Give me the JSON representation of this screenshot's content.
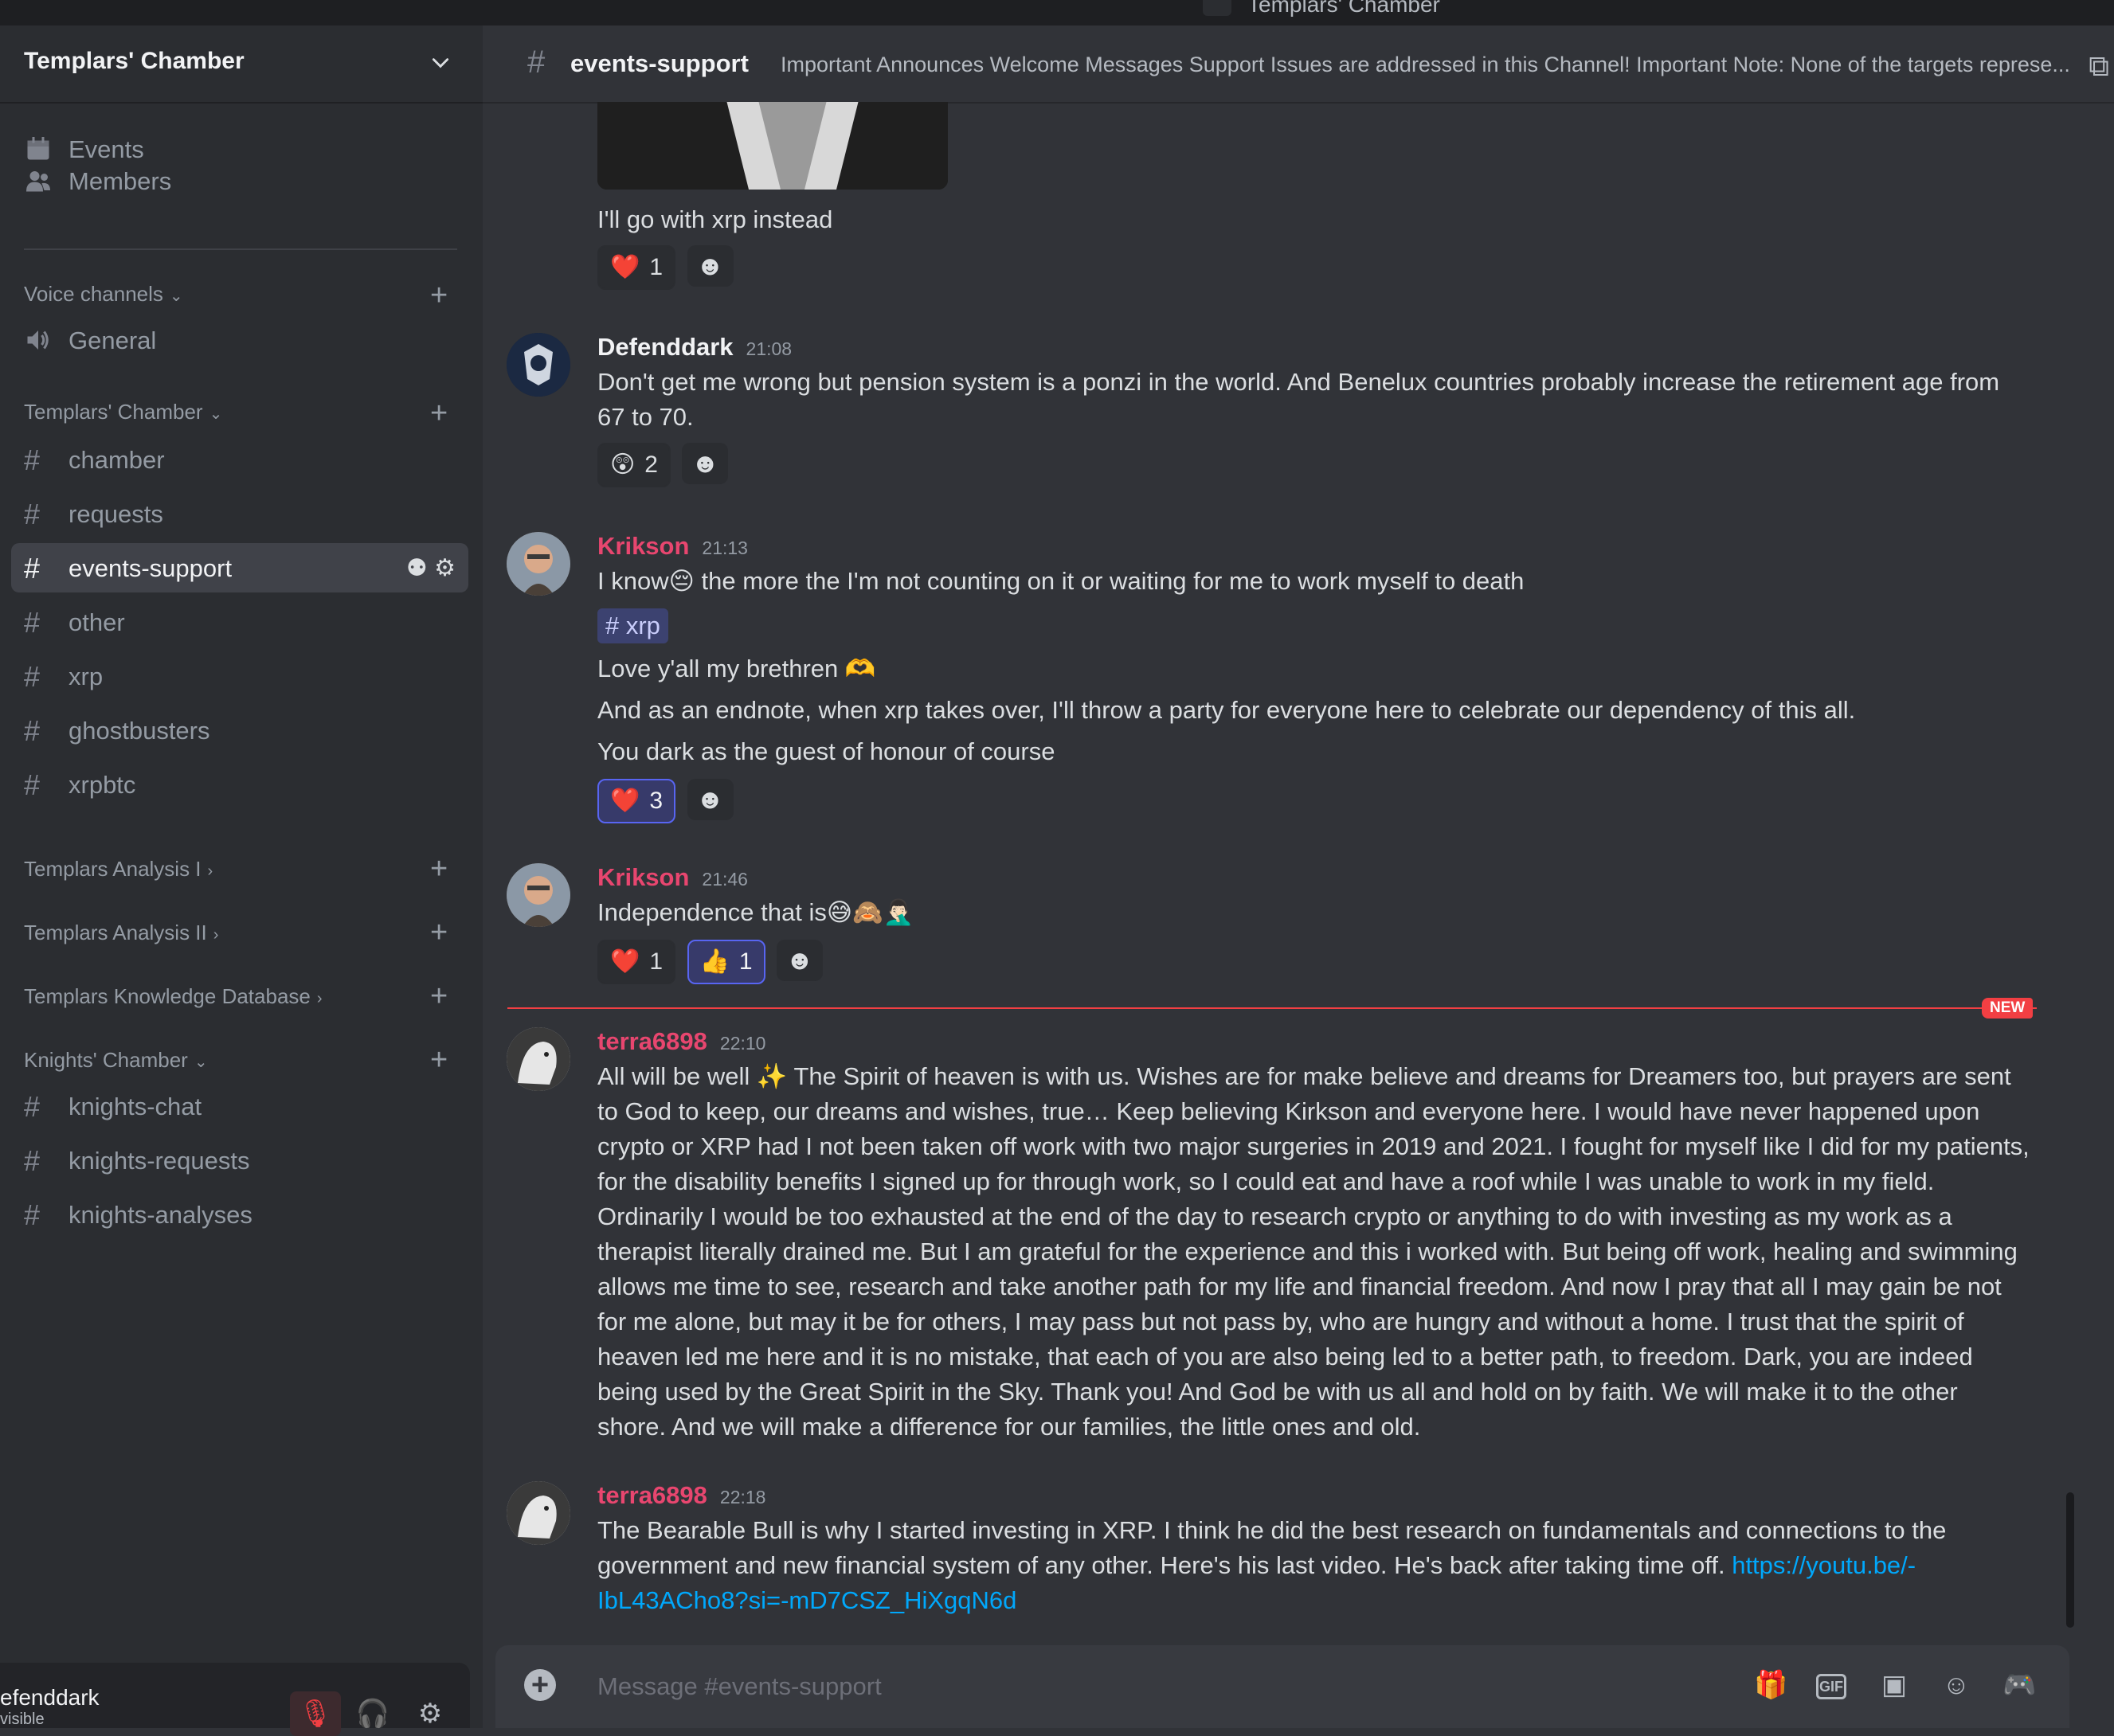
{
  "window": {
    "title": "Templars' Chamber"
  },
  "sidebar": {
    "server_name": "Templars' Chamber",
    "top_items": [
      {
        "label": "Events",
        "icon": "calendar-icon"
      },
      {
        "label": "Members",
        "icon": "members-icon"
      }
    ],
    "categories": {
      "voice": "Voice channels",
      "templars_chamber": "Templars' Chamber",
      "analysis_1": "Templars Analysis I",
      "analysis_2": "Templars Analysis II",
      "knowledge": "Templars Knowledge Database",
      "knights": "Knights' Chamber"
    },
    "voice_channels": [
      "General"
    ],
    "channels": [
      "chamber",
      "requests",
      "events-support",
      "other",
      "xrp",
      "ghostbusters",
      "xrpbtc"
    ],
    "active_channel": "events-support",
    "knights_channels": [
      "knights-chat",
      "knights-requests",
      "knights-analyses"
    ]
  },
  "user_panel": {
    "name": "efenddark",
    "status": "visible"
  },
  "channel": {
    "name": "events-support",
    "topic": "Important Announces Welcome Messages Support Issues are addressed in this Channel! Important Note: None of the targets represe..."
  },
  "messages": [
    {
      "author": "",
      "time": "",
      "text": "I'll go with xrp instead",
      "reactions": [
        {
          "emoji": "❤️",
          "count": "1",
          "mine": false
        }
      ]
    },
    {
      "author": "Defenddark",
      "time": "21:08",
      "text": "Don't get me wrong but pension system is a ponzi in the world. And Benelux countries probably increase the retirement age from 67 to 70.",
      "reactions": [
        {
          "emoji": "😲",
          "count": "2",
          "mine": false
        }
      ]
    },
    {
      "author": "Krikson",
      "time": "21:13",
      "line1": "I know😔 the  more the I'm not counting on it or waiting for me to work myself to death",
      "mention": "xrp",
      "line2": "Love y'all my brethren 🫶",
      "line3": "And as an endnote, when xrp takes over, I'll throw a party for everyone here to celebrate our dependency of this all.",
      "line4": "You dark as the guest of honour of course",
      "reactions": [
        {
          "emoji": "❤️",
          "count": "3",
          "mine": true
        }
      ]
    },
    {
      "author": "Krikson",
      "time": "21:46",
      "text": "Independence that is😅🙈🤦🏻‍♂️",
      "reactions": [
        {
          "emoji": "❤️",
          "count": "1",
          "mine": false
        },
        {
          "emoji": "👍",
          "count": "1",
          "mine": true
        }
      ]
    },
    {
      "author": "terra6898",
      "time": "22:10",
      "text": "All will be well ✨ The Spirit of heaven is with us. Wishes are for make believe and dreams for Dreamers too, but prayers are sent to God to keep, our dreams and wishes,  true… Keep believing Kirkson and everyone here. I would have never happened upon crypto or XRP had I not been taken off work with two major surgeries in 2019 and 2021.  I fought for myself like I did for my patients, for the disability benefits I signed up for through work, so I could eat and have a roof while I was  unable to work in my field. Ordinarily I would be too exhausted at the end of the day to research crypto or anything to do with investing as my work as a therapist literally drained me. But I am grateful for the experience and this i worked with. But being off work, healing and swimming allows me time to see, research and take another path for my life and financial freedom. And now I pray that all I may gain be not for me alone, but may it be for others, I may pass but not pass by,  who are hungry and without a home. I trust that the spirit of heaven led me here and it is no mistake, that each of you are also being led to a better path,  to freedom. Dark, you are  indeed being used by the Great Spirit in the Sky. Thank you! And God be with us all and hold on by faith. We will make it to the other shore. And we will make a difference for our families, the little ones and old."
    },
    {
      "author": "terra6898",
      "time": "22:18",
      "text": "The Bearable Bull is why I started investing in XRP. I think he did the best research on fundamentals and connections to the government and new financial system of any other. Here's his last video. He's back after taking time off. ",
      "link": "https://youtu.be/-IbL43ACho8?si=-mD7CSZ_HiXgqN6d"
    }
  ],
  "new_badge": "NEW",
  "composer": {
    "placeholder": "Message #events-support",
    "gif_label": "GIF"
  },
  "colors": {
    "accent": "#5865f2",
    "author_red": "#f23f43",
    "author_pink": "#e8466f",
    "link": "#00a8fc"
  }
}
